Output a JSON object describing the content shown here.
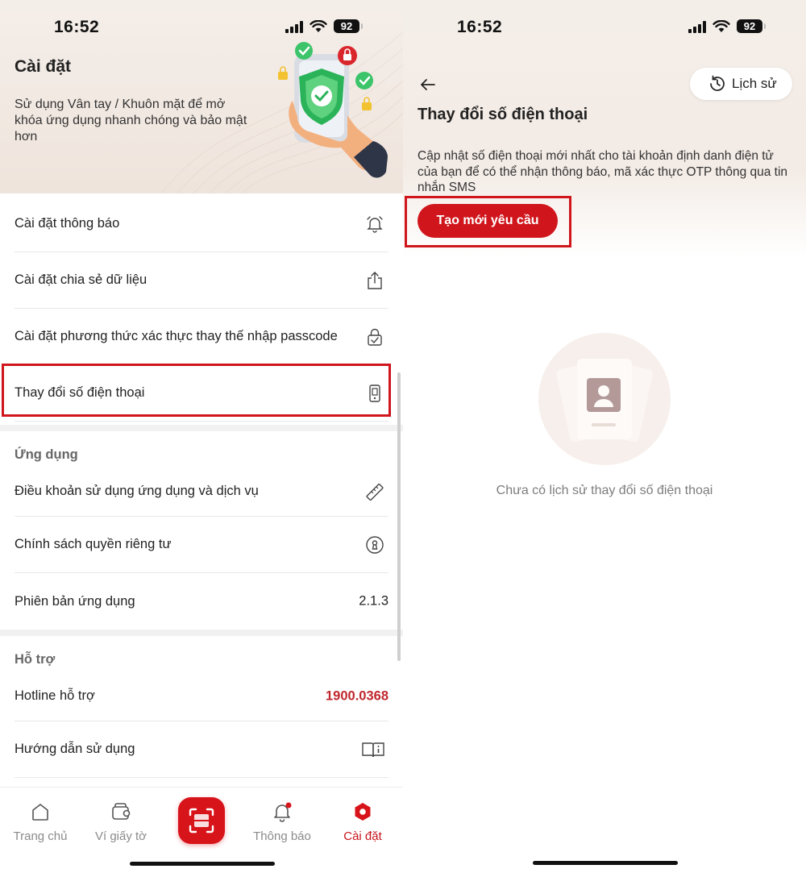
{
  "status_bar": {
    "time": "16:52",
    "battery": "92"
  },
  "left": {
    "header": {
      "title": "Cài đặt",
      "description": "Sử dụng Vân tay / Khuôn mặt để mở khóa ứng dụng nhanh chóng và bảo mật hơn"
    },
    "settings": [
      {
        "label": "Cài đặt thông báo",
        "icon": "alarm-bell-icon"
      },
      {
        "label": "Cài đặt chia sẻ dữ liệu",
        "icon": "share-upload-icon"
      },
      {
        "label": "Cài đặt phương thức xác thực thay thế nhập passcode",
        "icon": "lock-check-icon"
      },
      {
        "label": "Thay đổi số điện thoại",
        "icon": "phone-icon"
      }
    ],
    "app_section": {
      "title": "Ứng dụng",
      "items": [
        {
          "label": "Điều khoản sử dụng ứng dụng và dịch vụ",
          "icon": "ruler-icon"
        },
        {
          "label": "Chính sách quyền riêng tư",
          "icon": "keyhole-icon"
        },
        {
          "label": "Phiên bản ứng dụng",
          "value": "2.1.3"
        }
      ]
    },
    "support_section": {
      "title": "Hỗ trợ",
      "items": [
        {
          "label": "Hotline hỗ trợ",
          "value": "1900.0368"
        },
        {
          "label": "Hướng dẫn sử dụng",
          "icon": "book-info-icon"
        }
      ]
    },
    "bottom_nav": [
      {
        "label": "Trang chủ",
        "icon": "home-icon"
      },
      {
        "label": "Ví giấy tờ",
        "icon": "wallet-icon"
      },
      {
        "label": "",
        "icon": "scan-icon"
      },
      {
        "label": "Thông báo",
        "icon": "notification-bell-icon"
      },
      {
        "label": "Cài đặt",
        "icon": "settings-hexagon-icon"
      }
    ],
    "accent_color": "#d0161c"
  },
  "right": {
    "history_button": "Lịch sử",
    "title": "Thay đổi số điện thoại",
    "description": "Cập nhật số điện thoại mới nhất cho tài khoản định danh điện tử của bạn để có thể nhận thông báo, mã xác thực OTP thông qua tin nhắn SMS",
    "create_button": "Tạo mới yêu cầu",
    "empty_state": "Chưa có lịch sử thay đổi số điện thoại"
  }
}
